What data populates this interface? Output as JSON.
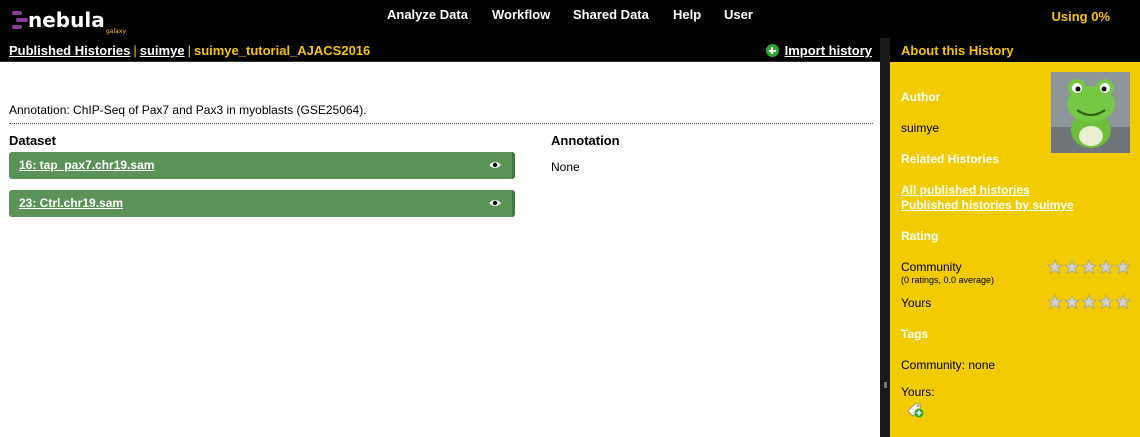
{
  "masthead": {
    "logo_text": "nebula",
    "logo_subtext": "galaxy",
    "nav": [
      "Analyze Data",
      "Workflow",
      "Shared Data",
      "Help",
      "User"
    ],
    "usage": "Using 0%"
  },
  "breadcrumb": {
    "items": [
      "Published Histories",
      "suimye"
    ],
    "current": "suimye_tutorial_AJACS2016",
    "separator": "|"
  },
  "import_history_label": "Import history",
  "annotation_line": "Annotation: ChIP-Seq of Pax7 and Pax3 in myoblasts (GSE25064).",
  "table": {
    "headers": [
      "Dataset",
      "Annotation"
    ],
    "rows": [
      {
        "name": "16: tap_pax7.chr19.sam",
        "annotation": "None"
      },
      {
        "name": "23: Ctrl.chr19.sam",
        "annotation": ""
      }
    ]
  },
  "panel": {
    "title": "About this History",
    "author_heading": "Author",
    "author": "suimye",
    "related_heading": "Related Histories",
    "related_links": [
      "All published histories",
      "Published histories by suimye"
    ],
    "rating_heading": "Rating",
    "community_label": "Community",
    "community_detail": "(0 ratings, 0.0 average)",
    "yours_label": "Yours",
    "tags_heading": "Tags",
    "community_tags": "Community: none",
    "your_tags_label": "Yours:"
  },
  "colors": {
    "accent": "#f2cc00",
    "dataset_ok": "#5a9258",
    "masthead": "#000000"
  }
}
